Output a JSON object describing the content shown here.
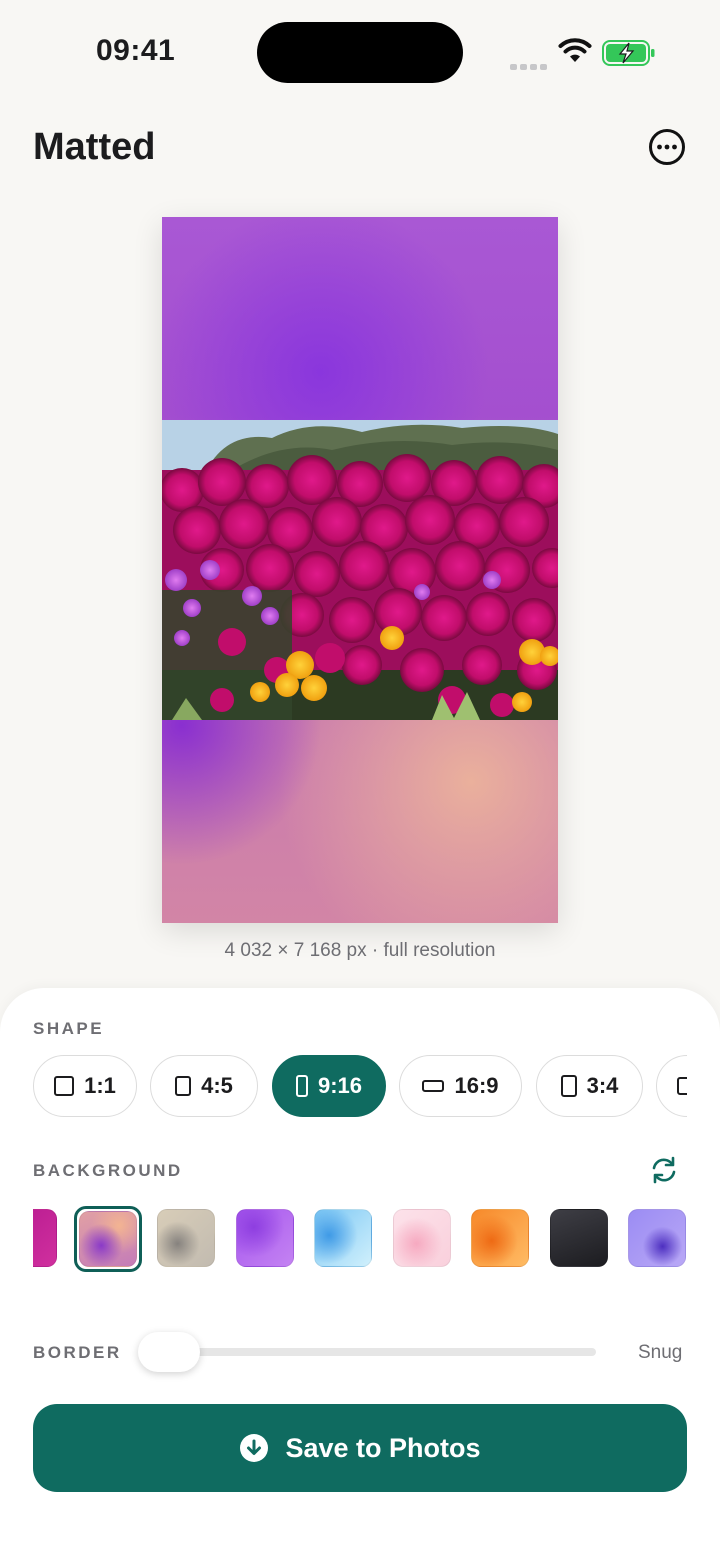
{
  "status_bar": {
    "time": "09:41"
  },
  "header": {
    "title": "Matted"
  },
  "preview": {
    "resolution_text": "4 032 × 7 168 px · full resolution"
  },
  "shape": {
    "label": "SHAPE",
    "options": [
      {
        "label": "1:1",
        "selected": false
      },
      {
        "label": "4:5",
        "selected": false
      },
      {
        "label": "9:16",
        "selected": true
      },
      {
        "label": "16:9",
        "selected": false
      },
      {
        "label": "3:4",
        "selected": false
      }
    ]
  },
  "background": {
    "label": "BACKGROUND",
    "swatches": [
      {
        "name": "magenta",
        "colors": [
          "#b5188f",
          "#d0309e"
        ],
        "selected": false
      },
      {
        "name": "purple-peach-blur",
        "colors": [
          "#8a40c8",
          "#f0b092"
        ],
        "selected": true
      },
      {
        "name": "taupe-gray",
        "colors": [
          "#c9bfae",
          "#8c8884"
        ],
        "selected": false
      },
      {
        "name": "violet",
        "colors": [
          "#9a4fe6",
          "#c07bf0"
        ],
        "selected": false
      },
      {
        "name": "sky-blue",
        "colors": [
          "#4aa5ec",
          "#bfe8fb"
        ],
        "selected": false
      },
      {
        "name": "pale-pink",
        "colors": [
          "#f8c6d5",
          "#fde7ee"
        ],
        "selected": false
      },
      {
        "name": "orange",
        "colors": [
          "#f27a1c",
          "#ffb55a"
        ],
        "selected": false
      },
      {
        "name": "charcoal",
        "colors": [
          "#222226",
          "#4a4a52"
        ],
        "selected": false
      },
      {
        "name": "indigo-blur",
        "colors": [
          "#8b7df0",
          "#5a3bc9"
        ],
        "selected": false
      }
    ]
  },
  "border": {
    "label": "BORDER",
    "value_label": "Snug",
    "value": 0.0
  },
  "actions": {
    "save_label": "Save to Photos"
  },
  "colors": {
    "accent": "#0f6b60",
    "background": "#f8f7f4"
  }
}
